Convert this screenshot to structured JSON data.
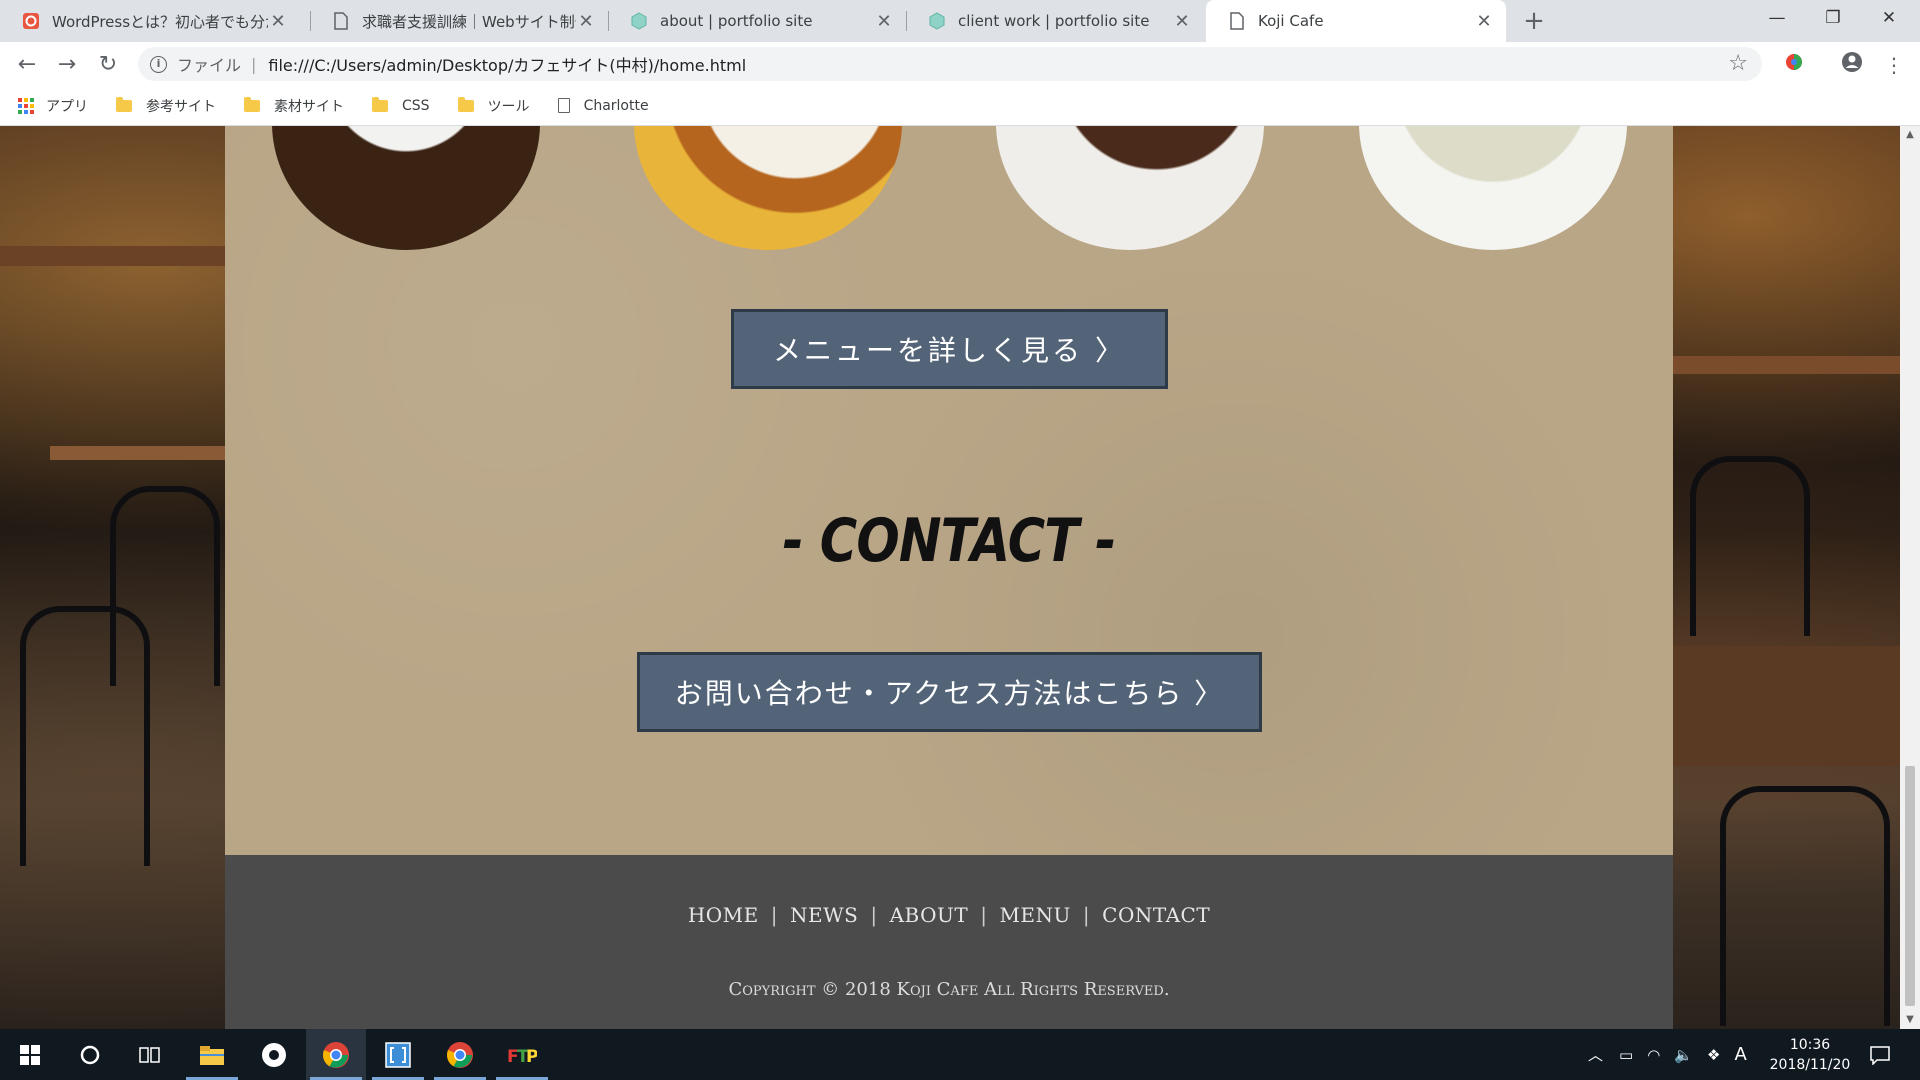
{
  "browser": {
    "tabs": [
      {
        "title": "WordPressとは？初心者でも分かる",
        "icon": "wordpress-icon"
      },
      {
        "title": "求職者支援訓練｜Webサイト制作",
        "icon": "page-icon"
      },
      {
        "title": "about | portfolio site",
        "icon": "cube-icon"
      },
      {
        "title": "client work | portfolio site",
        "icon": "cube-icon"
      },
      {
        "title": "Koji Cafe",
        "icon": "page-icon",
        "active": true
      }
    ],
    "address": {
      "scheme_label": "ファイル",
      "url": "file:///C:/Users/admin/Desktop/カフェサイト(中村)/home.html"
    },
    "bookmarks": [
      {
        "label": "アプリ",
        "icon": "apps-icon"
      },
      {
        "label": "参考サイト",
        "icon": "folder-icon"
      },
      {
        "label": "素材サイト",
        "icon": "folder-icon"
      },
      {
        "label": "CSS",
        "icon": "folder-icon"
      },
      {
        "label": "ツール",
        "icon": "folder-icon"
      },
      {
        "label": "Charlotte",
        "icon": "page-icon"
      }
    ]
  },
  "page": {
    "menu_button": "メニューを詳しく見る 〉",
    "contact_heading": "- CONTACT -",
    "contact_button": "お問い合わせ・アクセス方法はこちら 〉",
    "footer": {
      "nav": [
        "HOME",
        "NEWS",
        "ABOUT",
        "MENU",
        "CONTACT"
      ],
      "separator": "|",
      "copyright": "Copyright © 2018 Koji Cafe All Rights Reserved."
    },
    "colors": {
      "panel_bg": "#b9a687",
      "button_bg": "#536478",
      "footer_bg": "#4b4b4b"
    }
  },
  "taskbar": {
    "time": "10:36",
    "date": "2018/11/20",
    "ime": "A"
  }
}
